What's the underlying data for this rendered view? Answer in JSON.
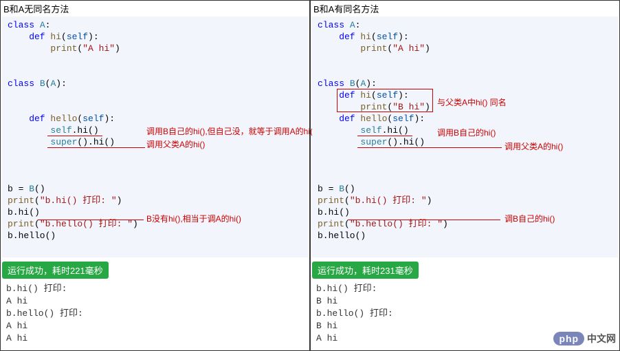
{
  "left": {
    "title": "B和A无同名方法",
    "c1": "class",
    "c2": "A",
    "c3": ":",
    "c4": "    def",
    "c5": " hi",
    "c6": "(",
    "c7": "self",
    "c8": "):",
    "c9": "        print",
    "c10": "(",
    "c11": "\"A hi\"",
    "c12": ")",
    "c13": "class",
    "c14": "B",
    "c15": "(",
    "c16": "A",
    "c17": "):",
    "c18": "    def",
    "c19": " hello",
    "c20": "(",
    "c21": "self",
    "c22": "):",
    "c23": "        self",
    "c24": ".hi()",
    "c25": "        super",
    "c26": "().hi()",
    "c27": "b = ",
    "c28": "B",
    "c29": "()",
    "c30": "print",
    "c31": "(",
    "c32": "\"b.hi() 打印: \"",
    "c33": ")",
    "c34": "b.hi()",
    "c35": "print",
    "c36": "(",
    "c37": "\"b.hello() 打印: \"",
    "c38": ")",
    "c39": "b.hello()",
    "anno1": "调用B自己的hi(),但自己没，就等于调用A的hi()",
    "anno2": "调用父类A的hi()",
    "anno3": "B没有hi(),相当于调A的hi()",
    "status": "运行成功，耗时221毫秒",
    "o1": "b.hi() 打印:",
    "o2": "A hi",
    "o3": "b.hello() 打印:",
    "o4": "A hi",
    "o5": "A hi"
  },
  "right": {
    "title": "B和A有同名方法",
    "c1": "class",
    "c2": "A",
    "c3": ":",
    "c4": "    def",
    "c5": " hi",
    "c6": "(",
    "c7": "self",
    "c8": "):",
    "c9": "        print",
    "c10": "(",
    "c11": "\"A hi\"",
    "c12": ")",
    "c13": "class",
    "c14": "B",
    "c15": "(",
    "c16": "A",
    "c17": "):",
    "r1a": "    def",
    "r1b": " hi",
    "r1c": "(",
    "r1d": "self",
    "r1e": "):",
    "r2a": "        print",
    "r2b": "(",
    "r2c": "\"B hi\"",
    "r2d": ")",
    "c18": "    def",
    "c19": " hello",
    "c20": "(",
    "c21": "self",
    "c22": "):",
    "c23": "        self",
    "c24": ".hi()",
    "c25": "        super",
    "c26": "().hi()",
    "c27": "b = ",
    "c28": "B",
    "c29": "()",
    "c30": "print",
    "c31": "(",
    "c32": "\"b.hi() 打印: \"",
    "c33": ")",
    "c34": "b.hi()",
    "c35": "print",
    "c36": "(",
    "c37": "\"b.hello() 打印: \"",
    "c38": ")",
    "c39": "b.hello()",
    "anno1": "与父类A中hi() 同名",
    "anno2": "调用B自己的hi()",
    "anno3": "调用父类A的hi()",
    "anno4": "调B自己的hi()",
    "status": "运行成功，耗时231毫秒",
    "o1": "b.hi() 打印:",
    "o2": "B hi",
    "o3": "b.hello() 打印:",
    "o4": "B hi",
    "o5": "A hi"
  },
  "watermark": {
    "php": "php",
    "cn": "中文网"
  }
}
